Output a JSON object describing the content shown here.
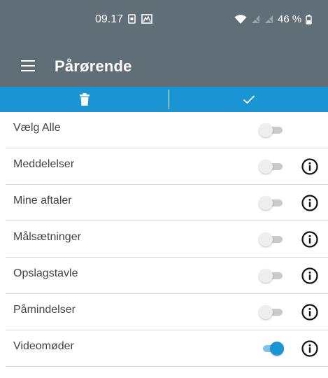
{
  "status_bar": {
    "time": "09.17",
    "battery": "46 %",
    "icons": [
      "sim-icon",
      "gallery-icon",
      "wifi-icon",
      "signal-icon",
      "signal-icon",
      "battery-icon"
    ]
  },
  "app_bar": {
    "title": "Pårørende",
    "menu_icon": "hamburger-menu-icon"
  },
  "action_bar": {
    "delete_icon": "trash-icon",
    "confirm_icon": "checkmark-icon",
    "color": "#1a94d3"
  },
  "items": [
    {
      "label": "Vælg Alle",
      "enabled": false,
      "has_info": false
    },
    {
      "label": "Meddelelser",
      "enabled": false,
      "has_info": true
    },
    {
      "label": "Mine aftaler",
      "enabled": false,
      "has_info": true
    },
    {
      "label": "Målsætninger",
      "enabled": false,
      "has_info": true
    },
    {
      "label": "Opslagstavle",
      "enabled": false,
      "has_info": true
    },
    {
      "label": "Påmindelser",
      "enabled": false,
      "has_info": true
    },
    {
      "label": "Videomøder",
      "enabled": true,
      "has_info": true
    }
  ],
  "colors": {
    "header": "#5f6e77",
    "accent": "#1a94d3"
  }
}
